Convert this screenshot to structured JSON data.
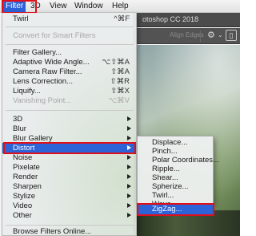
{
  "menubar": {
    "items": [
      "Filter",
      "3D",
      "View",
      "Window",
      "Help"
    ],
    "active": "Filter"
  },
  "photoshop": {
    "title_partial": "otoshop CC 2018",
    "align_edges": "Align Edges"
  },
  "filter_menu": {
    "top_items": [
      {
        "label": "Twirl",
        "shortcut": "^⌘F",
        "disabled": false
      }
    ],
    "group1": [
      {
        "label": "Convert for Smart Filters",
        "shortcut": "",
        "disabled": true
      }
    ],
    "group2": [
      {
        "label": "Filter Gallery...",
        "shortcut": "",
        "disabled": false
      },
      {
        "label": "Adaptive Wide Angle...",
        "shortcut": "⌥⇧⌘A",
        "disabled": false
      },
      {
        "label": "Camera Raw Filter...",
        "shortcut": "⇧⌘A",
        "disabled": false
      },
      {
        "label": "Lens Correction...",
        "shortcut": "⇧⌘R",
        "disabled": false
      },
      {
        "label": "Liquify...",
        "shortcut": "⇧⌘X",
        "disabled": false
      },
      {
        "label": "Vanishing Point...",
        "shortcut": "⌥⌘V",
        "disabled": true
      }
    ],
    "group3": [
      {
        "label": "3D"
      },
      {
        "label": "Blur"
      },
      {
        "label": "Blur Gallery"
      },
      {
        "label": "Distort",
        "highlighted": true
      },
      {
        "label": "Noise"
      },
      {
        "label": "Pixelate"
      },
      {
        "label": "Render"
      },
      {
        "label": "Sharpen"
      },
      {
        "label": "Stylize"
      },
      {
        "label": "Video"
      },
      {
        "label": "Other"
      }
    ],
    "group4": [
      {
        "label": "Browse Filters Online..."
      }
    ]
  },
  "distort_submenu": {
    "items": [
      {
        "label": "Displace..."
      },
      {
        "label": "Pinch..."
      },
      {
        "label": "Polar Coordinates..."
      },
      {
        "label": "Ripple..."
      },
      {
        "label": "Shear..."
      },
      {
        "label": "Spherize..."
      },
      {
        "label": "Twirl..."
      },
      {
        "label": "Wave..."
      },
      {
        "label": "ZigZag...",
        "highlighted": true
      }
    ]
  },
  "colors": {
    "highlight": "#2d63d8",
    "callout_box": "#e0101a",
    "menu_bg": "#e8ecec"
  }
}
